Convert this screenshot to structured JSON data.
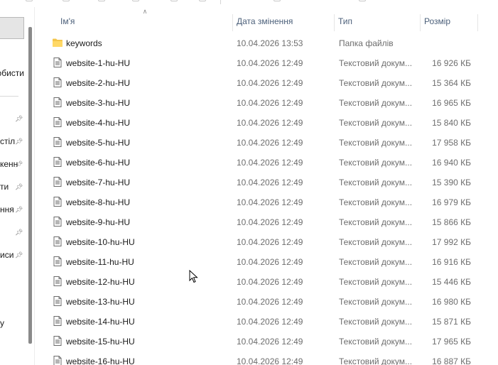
{
  "toolbar": {
    "icons": [
      "cut-icon",
      "copy-icon",
      "paste-icon",
      "rename-icon",
      "share-icon",
      "delete-icon"
    ]
  },
  "navigation": {
    "items": [
      {
        "text": "обисти",
        "pinned": false
      },
      {
        "text": "",
        "pinned": true
      },
      {
        "text": "стіл",
        "pinned": true
      },
      {
        "text": "кенн",
        "pinned": true
      },
      {
        "text": "ти",
        "pinned": true
      },
      {
        "text": "ння",
        "pinned": true
      },
      {
        "text": "",
        "pinned": true
      },
      {
        "text": "иси",
        "pinned": true
      },
      {
        "text": "у",
        "pinned": false
      }
    ]
  },
  "columns": {
    "name": "Ім'я",
    "date": "Дата змінення",
    "type": "Тип",
    "size": "Розмір"
  },
  "files": [
    {
      "name": "keywords",
      "date": "10.04.2026 13:53",
      "type": "Папка файлів",
      "size": "",
      "icon": "folder-icon"
    },
    {
      "name": "website-1-hu-HU",
      "date": "10.04.2026 12:49",
      "type": "Текстовий докум...",
      "size": "16 926 КБ",
      "icon": "text-file-icon"
    },
    {
      "name": "website-2-hu-HU",
      "date": "10.04.2026 12:49",
      "type": "Текстовий докум...",
      "size": "15 364 КБ",
      "icon": "text-file-icon"
    },
    {
      "name": "website-3-hu-HU",
      "date": "10.04.2026 12:49",
      "type": "Текстовий докум...",
      "size": "16 965 КБ",
      "icon": "text-file-icon"
    },
    {
      "name": "website-4-hu-HU",
      "date": "10.04.2026 12:49",
      "type": "Текстовий докум...",
      "size": "15 840 КБ",
      "icon": "text-file-icon"
    },
    {
      "name": "website-5-hu-HU",
      "date": "10.04.2026 12:49",
      "type": "Текстовий докум...",
      "size": "17 958 КБ",
      "icon": "text-file-icon"
    },
    {
      "name": "website-6-hu-HU",
      "date": "10.04.2026 12:49",
      "type": "Текстовий докум...",
      "size": "16 940 КБ",
      "icon": "text-file-icon"
    },
    {
      "name": "website-7-hu-HU",
      "date": "10.04.2026 12:49",
      "type": "Текстовий докум...",
      "size": "15 390 КБ",
      "icon": "text-file-icon"
    },
    {
      "name": "website-8-hu-HU",
      "date": "10.04.2026 12:49",
      "type": "Текстовий докум...",
      "size": "16 979 КБ",
      "icon": "text-file-icon"
    },
    {
      "name": "website-9-hu-HU",
      "date": "10.04.2026 12:49",
      "type": "Текстовий докум...",
      "size": "15 866 КБ",
      "icon": "text-file-icon"
    },
    {
      "name": "website-10-hu-HU",
      "date": "10.04.2026 12:49",
      "type": "Текстовий докум...",
      "size": "17 992 КБ",
      "icon": "text-file-icon"
    },
    {
      "name": "website-11-hu-HU",
      "date": "10.04.2026 12:49",
      "type": "Текстовий докум...",
      "size": "16 916 КБ",
      "icon": "text-file-icon"
    },
    {
      "name": "website-12-hu-HU",
      "date": "10.04.2026 12:49",
      "type": "Текстовий докум...",
      "size": "15 446 КБ",
      "icon": "text-file-icon"
    },
    {
      "name": "website-13-hu-HU",
      "date": "10.04.2026 12:49",
      "type": "Текстовий докум...",
      "size": "16 980 КБ",
      "icon": "text-file-icon"
    },
    {
      "name": "website-14-hu-HU",
      "date": "10.04.2026 12:49",
      "type": "Текстовий докум...",
      "size": "15 871 КБ",
      "icon": "text-file-icon"
    },
    {
      "name": "website-15-hu-HU",
      "date": "10.04.2026 12:49",
      "type": "Текстовий докум...",
      "size": "17 965 КБ",
      "icon": "text-file-icon"
    },
    {
      "name": "website-16-hu-HU",
      "date": "10.04.2026 12:49",
      "type": "Текстовий докум...",
      "size": "16 887 КБ",
      "icon": "text-file-icon"
    }
  ],
  "colors": {
    "header_text": "#4c607a",
    "folder": "#f4c54a",
    "nav_selected": "#e5e5e5"
  }
}
